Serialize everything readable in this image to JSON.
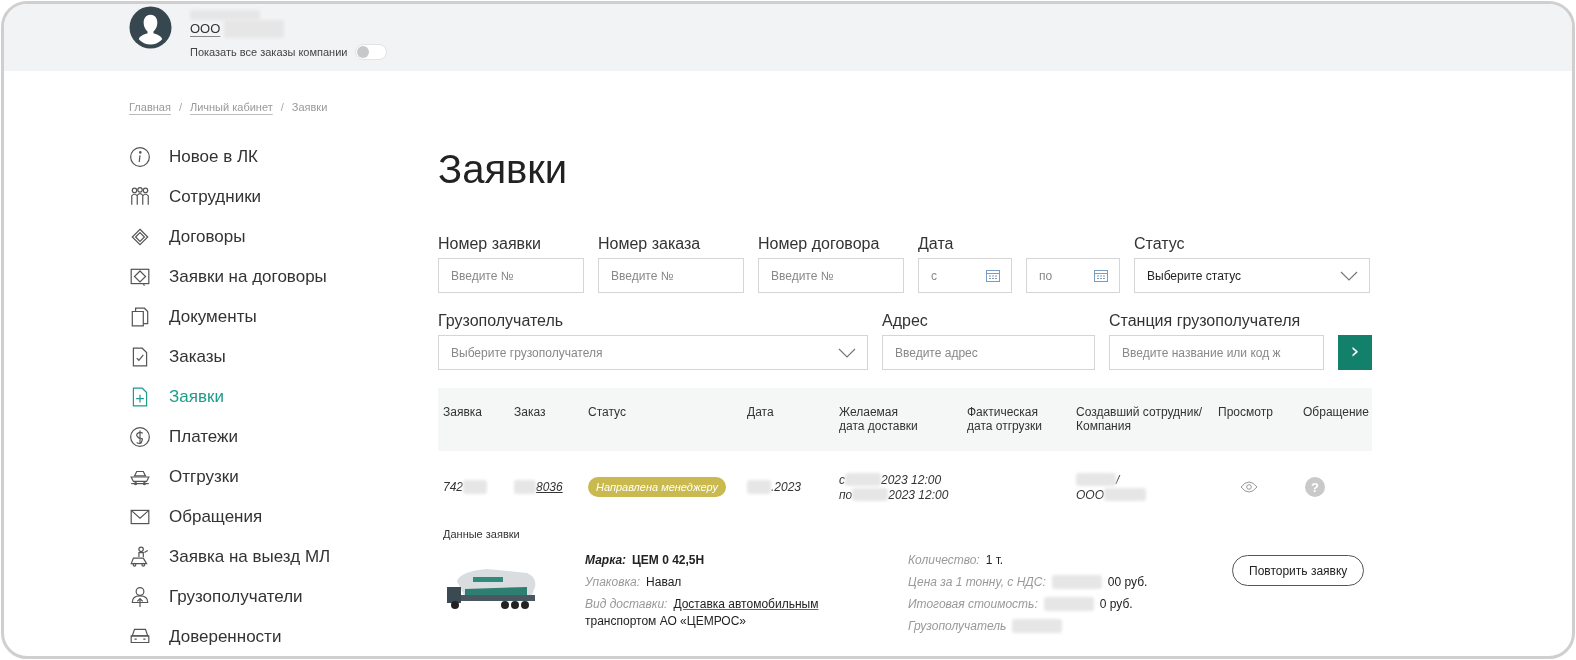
{
  "header": {
    "company": "ООО",
    "toggle_label": "Показать все заказы компании",
    "toggle_on": false
  },
  "breadcrumbs": [
    {
      "kind": "link",
      "label": "Главная"
    },
    {
      "kind": "separator",
      "label": "/"
    },
    {
      "kind": "link",
      "label": "Личный кабинет"
    },
    {
      "kind": "separator",
      "label": "/"
    },
    {
      "kind": "current",
      "label": "Заявки"
    }
  ],
  "sidebar": {
    "items": [
      {
        "label": "Новое в ЛК",
        "selected": false
      },
      {
        "label": "Сотрудники",
        "selected": false
      },
      {
        "label": "Договоры",
        "selected": false
      },
      {
        "label": "Заявки на договоры",
        "selected": false
      },
      {
        "label": "Документы",
        "selected": false
      },
      {
        "label": "Заказы",
        "selected": false
      },
      {
        "label": "Заявки",
        "selected": true
      },
      {
        "label": "Платежи",
        "selected": false
      },
      {
        "label": "Отгрузки",
        "selected": false
      },
      {
        "label": "Обращения",
        "selected": false
      },
      {
        "label": "Заявка на выезд МЛ",
        "selected": false
      },
      {
        "label": "Грузополучатели",
        "selected": false
      },
      {
        "label": "Доверенности",
        "selected": false
      }
    ]
  },
  "title": "Заявки",
  "filters": {
    "groups": [
      {
        "label": "Номер заявки",
        "fields": [
          {
            "kind": "text",
            "placeholder": "Введите №"
          }
        ]
      },
      {
        "label": "Номер заказа",
        "fields": [
          {
            "kind": "text",
            "placeholder": "Введите №"
          }
        ]
      },
      {
        "label": "Номер договора",
        "fields": [
          {
            "kind": "text",
            "placeholder": "Введите №"
          }
        ]
      },
      {
        "label": "Дата",
        "fields": [
          {
            "kind": "date",
            "placeholder": "с"
          },
          {
            "kind": "date",
            "placeholder": "по"
          }
        ]
      },
      {
        "label": "Статус",
        "fields": [
          {
            "kind": "select",
            "value": "Выберите статус"
          }
        ]
      },
      {
        "label": "Грузополучатель",
        "fields": [
          {
            "kind": "select",
            "placeholder": "Выберите грузополучателя"
          }
        ]
      },
      {
        "label": "Адрес",
        "fields": [
          {
            "kind": "text",
            "placeholder": "Введите адрес"
          }
        ]
      },
      {
        "label": "Станция грузополучателя",
        "fields": [
          {
            "kind": "text",
            "placeholder": "Введите название или код ж"
          }
        ]
      }
    ],
    "submit": "›"
  },
  "table": {
    "columns": [
      "Заявка",
      "Заказ",
      "Статус",
      "Дата",
      "Желаемая\nдата доставки",
      "Фактическая\nдата отгрузки",
      "Создавший сотрудник/\nКомпания",
      "Просмотр",
      "Обращение"
    ],
    "rows": [
      {
        "request": "742",
        "order": "8036",
        "status": {
          "text": "Направлена менеджеру",
          "color": "#c9b94e"
        },
        "date": ".2023",
        "desired_delivery": [
          {
            "prefix": "с",
            "value": "2023 12:00"
          },
          {
            "prefix": "по",
            "value": "2023 12:00"
          }
        ],
        "creator": {
          "line_1": "/",
          "line_2": "ООО"
        },
        "appeal": "?"
      }
    ]
  },
  "details": {
    "title": "Данные заявки",
    "left": [
      {
        "kind": "brand",
        "label": "Марка:",
        "value": "ЦЕМ 0 42,5Н"
      },
      {
        "kind": "plain",
        "label": "Упаковка:",
        "value": "Навал"
      },
      {
        "kind": "link",
        "label": "Вид доставки:",
        "value": "Доставка автомобильным",
        "continuation": "транспортом АО «ЦЕМРОС»"
      }
    ],
    "right": [
      {
        "label": "Количество:",
        "value": "1 т.",
        "redacted": false
      },
      {
        "label": "Цена за 1 тонну, с НДС:",
        "value": "00 руб.",
        "redacted": true
      },
      {
        "label": "Итоговая стоимость:",
        "value": "0 руб.",
        "redacted": true
      },
      {
        "label": "Грузополучатель",
        "redacted": true
      }
    ],
    "button": "Повторить заявку"
  }
}
